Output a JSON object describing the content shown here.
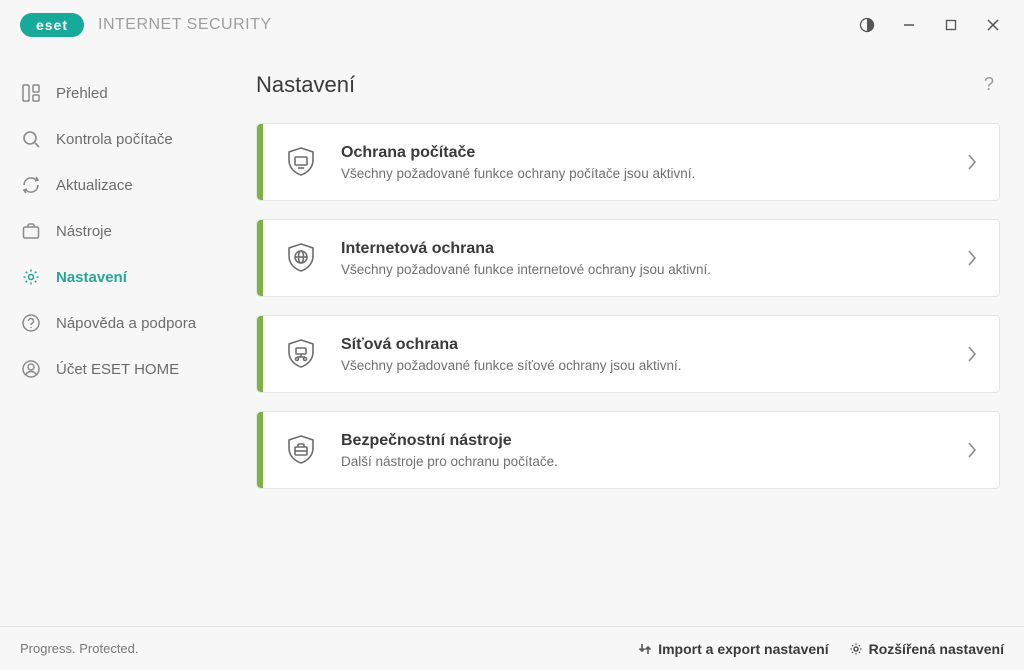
{
  "brand": {
    "name": "ESET",
    "product": "INTERNET SECURITY"
  },
  "sidebar": {
    "items": [
      {
        "label": "Přehled"
      },
      {
        "label": "Kontrola počítače"
      },
      {
        "label": "Aktualizace"
      },
      {
        "label": "Nástroje"
      },
      {
        "label": "Nastavení"
      },
      {
        "label": "Nápověda a podpora"
      },
      {
        "label": "Účet ESET HOME"
      }
    ],
    "active_index": 4
  },
  "page": {
    "title": "Nastavení",
    "help_symbol": "?"
  },
  "cards": [
    {
      "title": "Ochrana počítače",
      "desc": "Všechny požadované funkce ochrany počítače jsou aktivní.",
      "icon": "shield-monitor"
    },
    {
      "title": "Internetová ochrana",
      "desc": "Všechny požadované funkce internetové ochrany jsou aktivní.",
      "icon": "shield-globe"
    },
    {
      "title": "Síťová ochrana",
      "desc": "Všechny požadované funkce síťové ochrany jsou aktivní.",
      "icon": "shield-network"
    },
    {
      "title": "Bezpečnostní nástroje",
      "desc": "Další nástroje pro ochranu počítače.",
      "icon": "shield-toolbox"
    }
  ],
  "footer": {
    "tagline": "Progress. Protected.",
    "import_export": "Import a export nastavení",
    "advanced": "Rozšířená nastavení"
  }
}
